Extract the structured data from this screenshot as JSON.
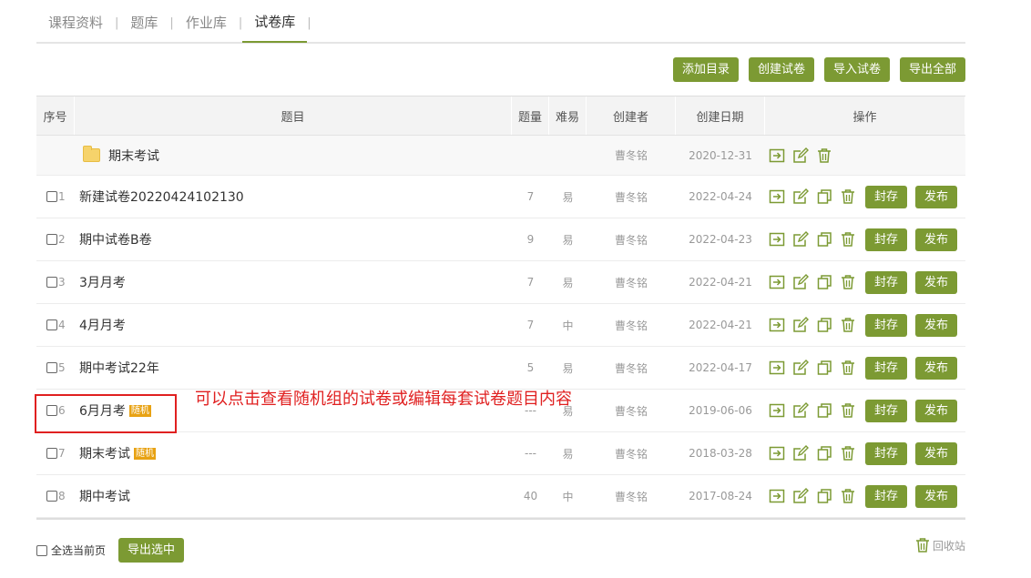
{
  "tabs": [
    {
      "label": "课程资料",
      "active": false
    },
    {
      "label": "题库",
      "active": false
    },
    {
      "label": "作业库",
      "active": false
    },
    {
      "label": "试卷库",
      "active": true
    }
  ],
  "tab_separator": "|",
  "actions": {
    "add_dir": "添加目录",
    "create_paper": "创建试卷",
    "import_paper": "导入试卷",
    "export_all": "导出全部"
  },
  "columns": {
    "idx": "序号",
    "title": "题目",
    "count": "题量",
    "difficulty": "难易",
    "creator": "创建者",
    "date": "创建日期",
    "ops": "操作"
  },
  "folder": {
    "name": "期末考试",
    "creator": "曹冬铭",
    "date": "2020-12-31"
  },
  "rows": [
    {
      "idx": "1",
      "title": "新建试卷20220424102130",
      "tag": "",
      "count": "7",
      "difficulty": "易",
      "creator": "曹冬铭",
      "date": "2022-04-24"
    },
    {
      "idx": "2",
      "title": "期中试卷B卷",
      "tag": "",
      "count": "9",
      "difficulty": "易",
      "creator": "曹冬铭",
      "date": "2022-04-23"
    },
    {
      "idx": "3",
      "title": "3月月考",
      "tag": "",
      "count": "7",
      "difficulty": "易",
      "creator": "曹冬铭",
      "date": "2022-04-21"
    },
    {
      "idx": "4",
      "title": "4月月考",
      "tag": "",
      "count": "7",
      "difficulty": "中",
      "creator": "曹冬铭",
      "date": "2022-04-21"
    },
    {
      "idx": "5",
      "title": "期中考试22年",
      "tag": "",
      "count": "5",
      "difficulty": "易",
      "creator": "曹冬铭",
      "date": "2022-04-17"
    },
    {
      "idx": "6",
      "title": "6月月考",
      "tag": "随机",
      "count": "---",
      "difficulty": "易",
      "creator": "曹冬铭",
      "date": "2019-06-06"
    },
    {
      "idx": "7",
      "title": "期末考试",
      "tag": "随机",
      "count": "---",
      "difficulty": "易",
      "creator": "曹冬铭",
      "date": "2018-03-28"
    },
    {
      "idx": "8",
      "title": "期中考试",
      "tag": "",
      "count": "40",
      "difficulty": "中",
      "creator": "曹冬铭",
      "date": "2017-08-24"
    }
  ],
  "row_buttons": {
    "archive": "封存",
    "publish": "发布"
  },
  "annotation": "可以点击查看随机组的试卷或编辑每套试卷题目内容",
  "bottom": {
    "select_page": "全选当前页",
    "export_selected": "导出选中"
  },
  "recycle_bin": "回收站",
  "colors": {
    "accent": "#7c9a33",
    "tag": "#e8a213",
    "annotation": "#e02020"
  },
  "icons": [
    "move-icon",
    "edit-icon",
    "copy-icon",
    "trash-icon",
    "folder-icon",
    "checkbox-icon"
  ]
}
